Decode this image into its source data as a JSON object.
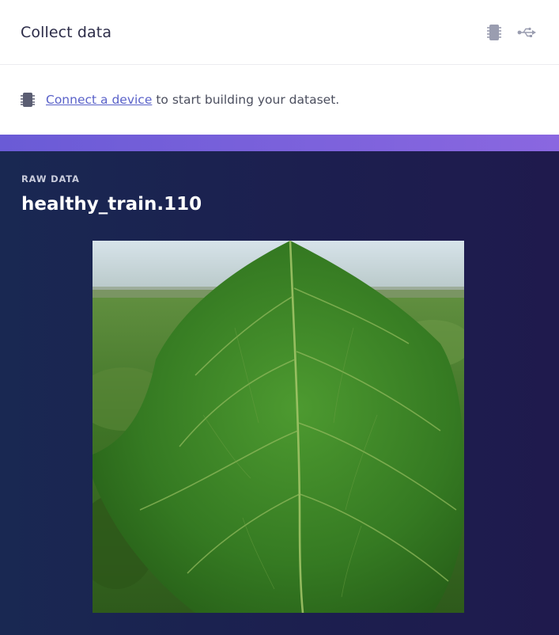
{
  "collect": {
    "title": "Collect data",
    "icons": [
      "chip-icon",
      "usb-icon"
    ],
    "connect_link": "Connect a device",
    "connect_rest": "to start building your dataset."
  },
  "raw_data": {
    "label": "RAW DATA",
    "sample_name": "healthy_train.110",
    "image": "green-leaf-photo"
  },
  "colors": {
    "accent": "#7a61dc",
    "link": "#5a62c9",
    "panel_bg": "#1c2252"
  }
}
